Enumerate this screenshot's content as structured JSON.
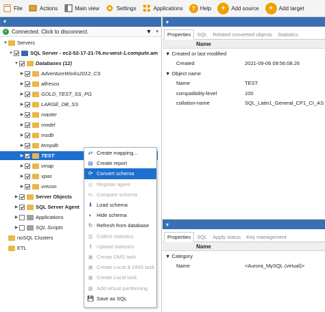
{
  "toolbar": {
    "file": "File",
    "actions": "Actions",
    "main_view": "Main view",
    "settings": "Settings",
    "applications": "Applications",
    "help": "Help",
    "add_source": "Add source",
    "add_target": "Add target"
  },
  "connection": {
    "status": "Connected. Click to disconnect."
  },
  "tree": {
    "servers": "Servers",
    "sql_server": "SQL Server - ec2-52-17-21-76.eu-west-1.compute.am",
    "databases": "Databases (12)",
    "dbs": [
      "AdventureWorks2012_CS",
      "alfresco",
      "GOLD_TEST_SS_PG",
      "LARGE_DB_SS",
      "master",
      "model",
      "msdb",
      "tempdb",
      "TEST",
      "vmap",
      "vpas",
      "vrecon"
    ],
    "server_objects": "Server Objects",
    "sql_server_agent": "SQL Server Agent",
    "applications": "Applications",
    "sql_scripts": "SQL Scripts",
    "nosql_clusters": "noSQL Clusters",
    "etl": "ETL"
  },
  "context_menu": [
    {
      "label": "Create mapping...",
      "enabled": true
    },
    {
      "label": "Create report",
      "enabled": true
    },
    {
      "label": "Convert schema",
      "enabled": true,
      "highlighted": true
    },
    {
      "label": "Register agent",
      "enabled": false
    },
    {
      "label": "Compare schema",
      "enabled": false
    },
    {
      "label": "Load schema",
      "enabled": true
    },
    {
      "label": "Hide schema",
      "enabled": true
    },
    {
      "label": "Refresh from database",
      "enabled": true
    },
    {
      "label": "Collect statistics",
      "enabled": false
    },
    {
      "label": "Upload statistics",
      "enabled": false
    },
    {
      "label": "Create DMS task",
      "enabled": false
    },
    {
      "label": "Create Local & DMS task",
      "enabled": false
    },
    {
      "label": "Create Local task",
      "enabled": false
    },
    {
      "label": "Add virtual partitioning",
      "enabled": false
    },
    {
      "label": "Save as SQL",
      "enabled": true
    }
  ],
  "top_pane": {
    "tabs": [
      "Properties",
      "SQL",
      "Related converted objects",
      "Statistics"
    ],
    "column_header": "Name",
    "categories": [
      {
        "name": "Created or last modified",
        "props": [
          {
            "key": "Created",
            "value": "2021-09-06 09:56:08.26"
          }
        ]
      },
      {
        "name": "Object name",
        "props": [
          {
            "key": "Name",
            "value": "TEST"
          },
          {
            "key": "compatibility-level",
            "value": "100"
          },
          {
            "key": "collation-name",
            "value": "SQL_Latin1_General_CP1_CI_AS"
          }
        ]
      }
    ]
  },
  "bottom_pane": {
    "tabs": [
      "Properties",
      "SQL",
      "Apply status",
      "Key management"
    ],
    "column_header": "Name",
    "categories": [
      {
        "name": "Category",
        "props": [
          {
            "key": "Name",
            "value": "<Aurora_MySQL (virtual)>"
          }
        ]
      }
    ]
  },
  "colors": {
    "accent": "#1f6fd1",
    "pane_bar": "#3b6fb3",
    "toolbar_button": "#f0a000",
    "connected": "#2ea043"
  }
}
